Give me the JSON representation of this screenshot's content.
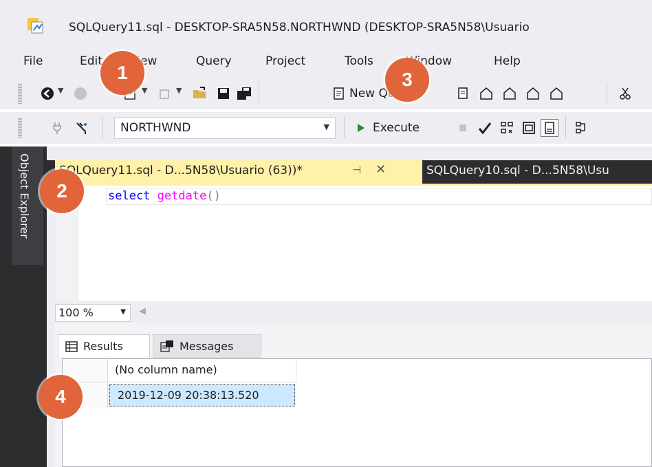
{
  "window": {
    "title": "SQLQuery11.sql - DESKTOP-SRA5N58.NORTHWND (DESKTOP-SRA5N58\\Usuario"
  },
  "menu": {
    "items": [
      "File",
      "Edit",
      "View",
      "Query",
      "Project",
      "Tools",
      "Window",
      "Help"
    ]
  },
  "toolbar": {
    "new_query_label": "New Query",
    "database_value": "NORTHWND",
    "execute_label": "Execute",
    "icons": [
      "back-icon",
      "forward-icon",
      "new-project-icon",
      "add-item-icon",
      "open-folder-icon",
      "save-icon",
      "save-all-icon",
      "new-query-icon",
      "mdx-icon",
      "dmx-icon",
      "xmla-icon",
      "dax-icon",
      "cut-icon",
      "connect-icon",
      "filter-icon",
      "stop-icon",
      "parse-check-icon",
      "estimated-plan-icon",
      "results-to-text-icon",
      "results-to-grid-icon",
      "query-options-icon"
    ]
  },
  "sidebar": {
    "object_explorer_label": "Object Explorer"
  },
  "tabs": [
    {
      "label": "SQLQuery11.sql - D...5N58\\Usuario (63))*",
      "active": true
    },
    {
      "label": "SQLQuery10.sql - D...5N58\\Usu",
      "active": false
    }
  ],
  "editor": {
    "kw": "select",
    "fn": "getdate",
    "paren": "()"
  },
  "zoom": {
    "value": "100 %"
  },
  "results": {
    "tabs": [
      "Results",
      "Messages"
    ],
    "columns": [
      "(No column name)"
    ],
    "rows": [
      [
        "2019-12-09 20:38:13.520"
      ]
    ]
  },
  "annotations": [
    "1",
    "2",
    "3",
    "4"
  ],
  "colors": {
    "badge": "#e2643a",
    "active_tab": "#fff1a8",
    "dark_chrome": "#2d2d30",
    "selected_cell": "#cde8ff"
  }
}
